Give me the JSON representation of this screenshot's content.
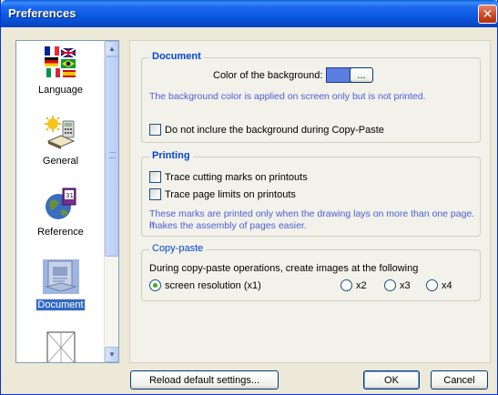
{
  "window": {
    "title": "Preferences",
    "close_glyph": "✕"
  },
  "sidebar": {
    "items": [
      {
        "label": "Language",
        "icon": "flags-icon"
      },
      {
        "label": "General",
        "icon": "general-settings-icon"
      },
      {
        "label": "Reference",
        "icon": "globe-book-icon"
      },
      {
        "label": "Document",
        "icon": "document-icon",
        "selected": true
      },
      {
        "label": "",
        "icon": "page-layout-icon"
      }
    ],
    "scroll_up": "▲",
    "scroll_down": "▼"
  },
  "document_group": {
    "legend": "Document",
    "bg_color_label": "Color of the background:",
    "bg_color": "#5b7fe0",
    "browse_label": "...",
    "note": "The background color is applied on screen only but is not printed.",
    "exclude_bg_label": "Do not inclure the background during Copy-Paste"
  },
  "printing_group": {
    "legend": "Printing",
    "trace_cutting_label": "Trace cutting marks on printouts",
    "trace_limits_label": "Trace page limits on printouts",
    "note_line1": "These marks are printed only when the drawing lays on more than one page. It",
    "note_line2": "makes the assembly of pages easier."
  },
  "copypaste_group": {
    "legend": "Copy-paste",
    "description": "During copy-paste operations, create images at the following",
    "options": [
      {
        "label": "screen resolution (x1)",
        "selected": true
      },
      {
        "label": "x2",
        "selected": false
      },
      {
        "label": "x3",
        "selected": false
      },
      {
        "label": "x4",
        "selected": false
      }
    ]
  },
  "buttons": {
    "reload": "Reload default settings...",
    "ok": "OK",
    "cancel": "Cancel"
  },
  "colors": {
    "title_bar": "#0a58e0",
    "accent_text": "#0046d5",
    "note_text": "#4c5ed9",
    "selection": "#316ac5"
  }
}
